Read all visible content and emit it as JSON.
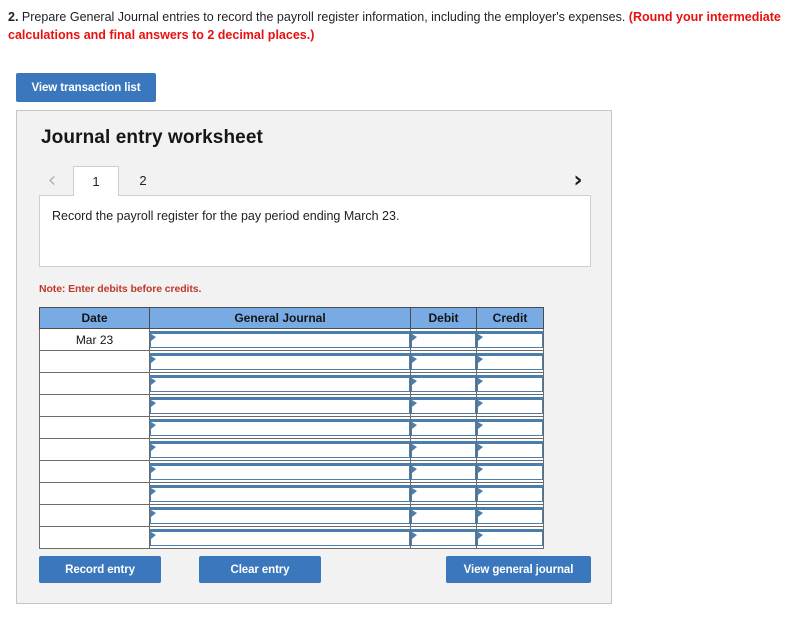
{
  "question": {
    "number": "2.",
    "text": " Prepare General Journal entries to record the payroll register information, including the employer's expenses. ",
    "round_note": "(Round your intermediate calculations and final answers to 2 decimal places.)"
  },
  "toolbar": {
    "view_transaction_list_label": "View transaction list"
  },
  "worksheet": {
    "title": "Journal entry worksheet",
    "prev_chevron": "‹",
    "next_chevron": "›",
    "tabs": [
      {
        "label": "1",
        "active": true
      },
      {
        "label": "2",
        "active": false
      }
    ],
    "description": "Record the payroll register for the pay period ending March 23.",
    "note": "Note: Enter debits before credits."
  },
  "journal_table": {
    "columns": [
      "Date",
      "General Journal",
      "Debit",
      "Credit"
    ],
    "rows": [
      {
        "date": "Mar 23",
        "general_journal": "",
        "debit": "",
        "credit": ""
      },
      {
        "date": "",
        "general_journal": "",
        "debit": "",
        "credit": ""
      },
      {
        "date": "",
        "general_journal": "",
        "debit": "",
        "credit": ""
      },
      {
        "date": "",
        "general_journal": "",
        "debit": "",
        "credit": ""
      },
      {
        "date": "",
        "general_journal": "",
        "debit": "",
        "credit": ""
      },
      {
        "date": "",
        "general_journal": "",
        "debit": "",
        "credit": ""
      },
      {
        "date": "",
        "general_journal": "",
        "debit": "",
        "credit": ""
      },
      {
        "date": "",
        "general_journal": "",
        "debit": "",
        "credit": ""
      },
      {
        "date": "",
        "general_journal": "",
        "debit": "",
        "credit": ""
      },
      {
        "date": "",
        "general_journal": "",
        "debit": "",
        "credit": ""
      }
    ]
  },
  "actions": {
    "record_entry_label": "Record entry",
    "clear_entry_label": "Clear entry",
    "view_general_journal_label": "View general journal"
  },
  "colors": {
    "button_blue": "#3a77bd",
    "table_header_blue": "#78aae4",
    "input_border_blue": "#4a7ead",
    "note_red": "#c0392b",
    "prompt_red": "#e8110f",
    "panel_gray": "#f2f2f2"
  }
}
